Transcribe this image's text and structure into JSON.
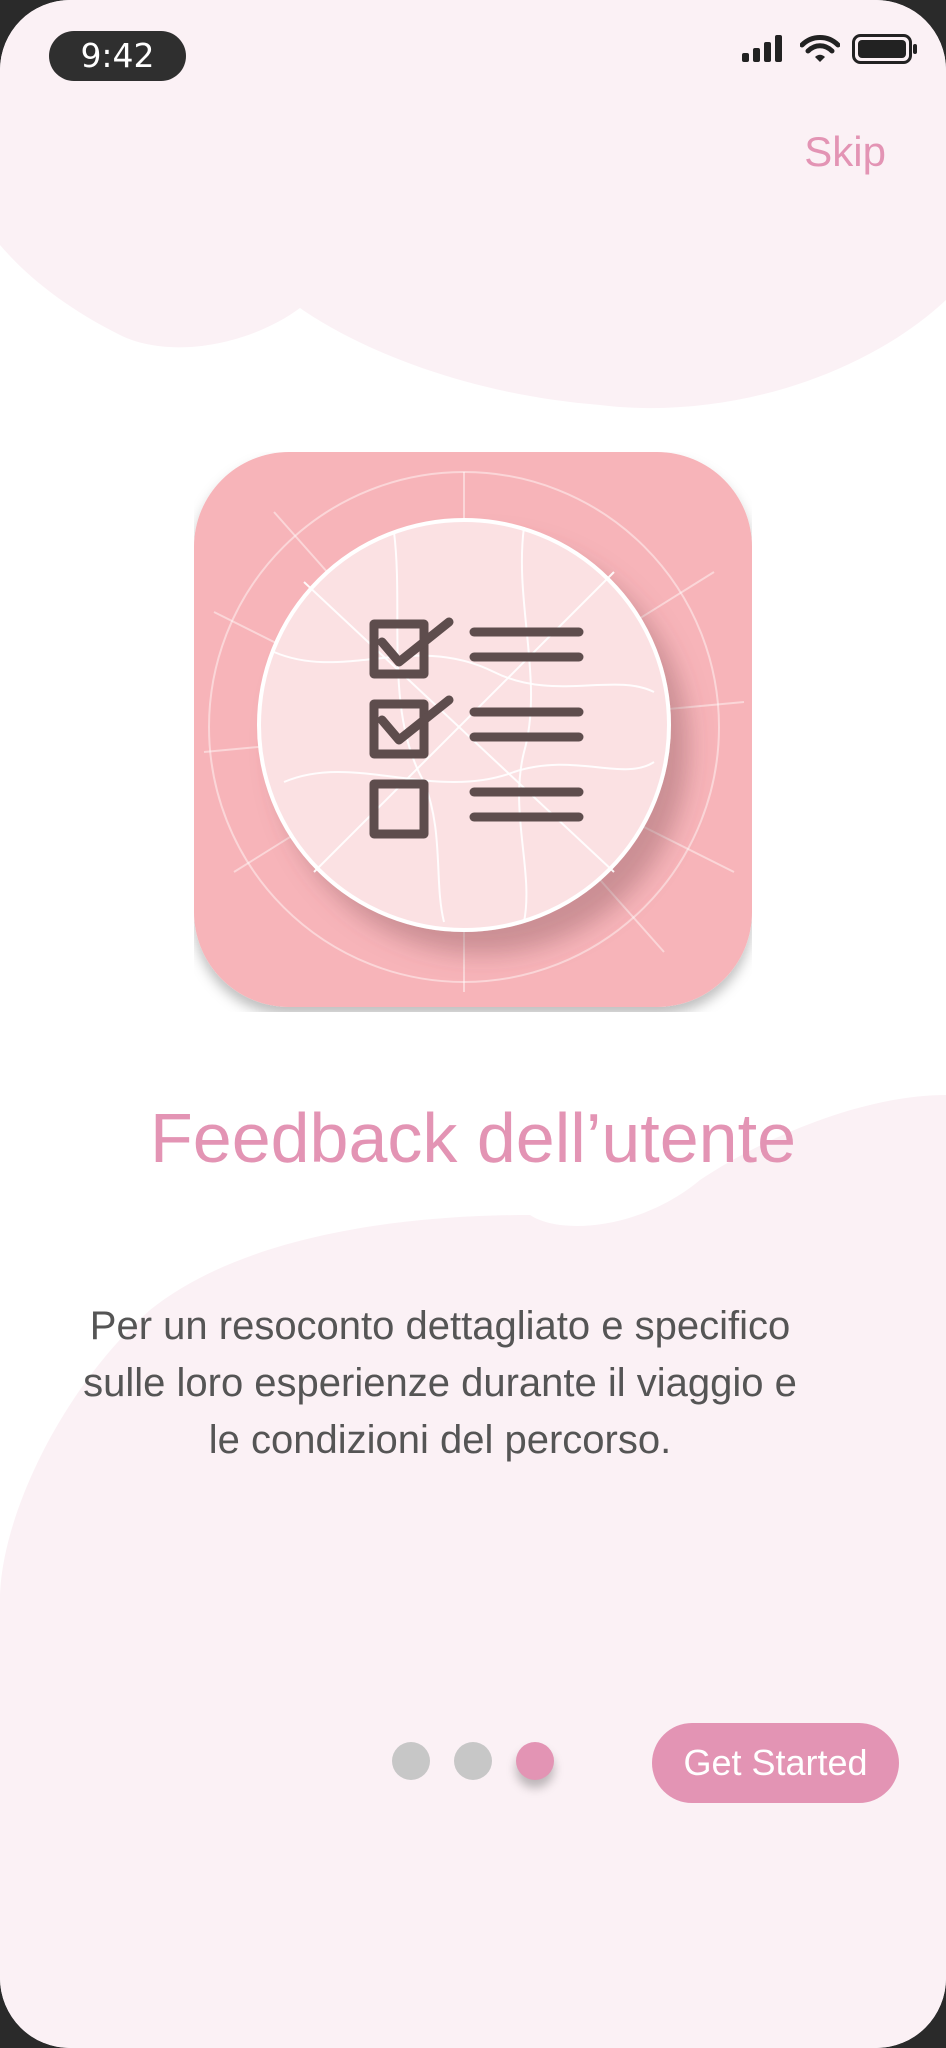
{
  "status_bar": {
    "time": "9:42"
  },
  "header": {
    "skip_label": "Skip"
  },
  "onboarding": {
    "title": "Feedback dell’utente",
    "description_lines": [
      "Per un resoconto dettagliato e specifico",
      "sulle loro esperienze durante il viaggio e",
      "le condizioni del percorso."
    ],
    "illustration_icon": "checklist-icon",
    "page_indicator": {
      "total": 3,
      "current": 3
    },
    "cta_label": "Get Started"
  },
  "colors": {
    "accent": "#e394b4",
    "background_blob": "#fbf1f5",
    "icon_tile": "#f7b4b9",
    "text_body": "#555555",
    "dot_inactive": "#c7c7c7"
  }
}
